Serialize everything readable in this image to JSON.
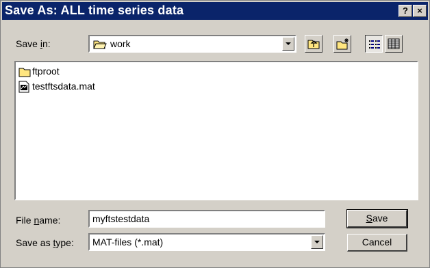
{
  "window": {
    "title": "Save As: ALL time series data",
    "help_label": "?",
    "close_label": "×"
  },
  "save_in": {
    "label_pre": "Save ",
    "label_acc": "i",
    "label_post": "n:",
    "value": "work"
  },
  "toolbar": {
    "icons": [
      "up-one-level-icon",
      "create-new-folder-icon",
      "list-view-icon",
      "details-view-icon"
    ]
  },
  "files": [
    {
      "name": "ftproot",
      "icon": "folder-icon"
    },
    {
      "name": "testftsdata.mat",
      "icon": "mat-file-icon"
    }
  ],
  "file_name": {
    "label_pre": "File ",
    "label_acc": "n",
    "label_post": "ame:",
    "value": "myftstestdata"
  },
  "save_as_type": {
    "label_pre": "Save as ",
    "label_acc": "t",
    "label_post": "ype:",
    "value": "MAT-files (*.mat)"
  },
  "buttons": {
    "save_acc": "S",
    "save_post": "ave",
    "cancel": "Cancel"
  },
  "colors": {
    "title_bar": "#0a246a",
    "dialog_face": "#d4d0c8",
    "folder": "#ffe680"
  }
}
